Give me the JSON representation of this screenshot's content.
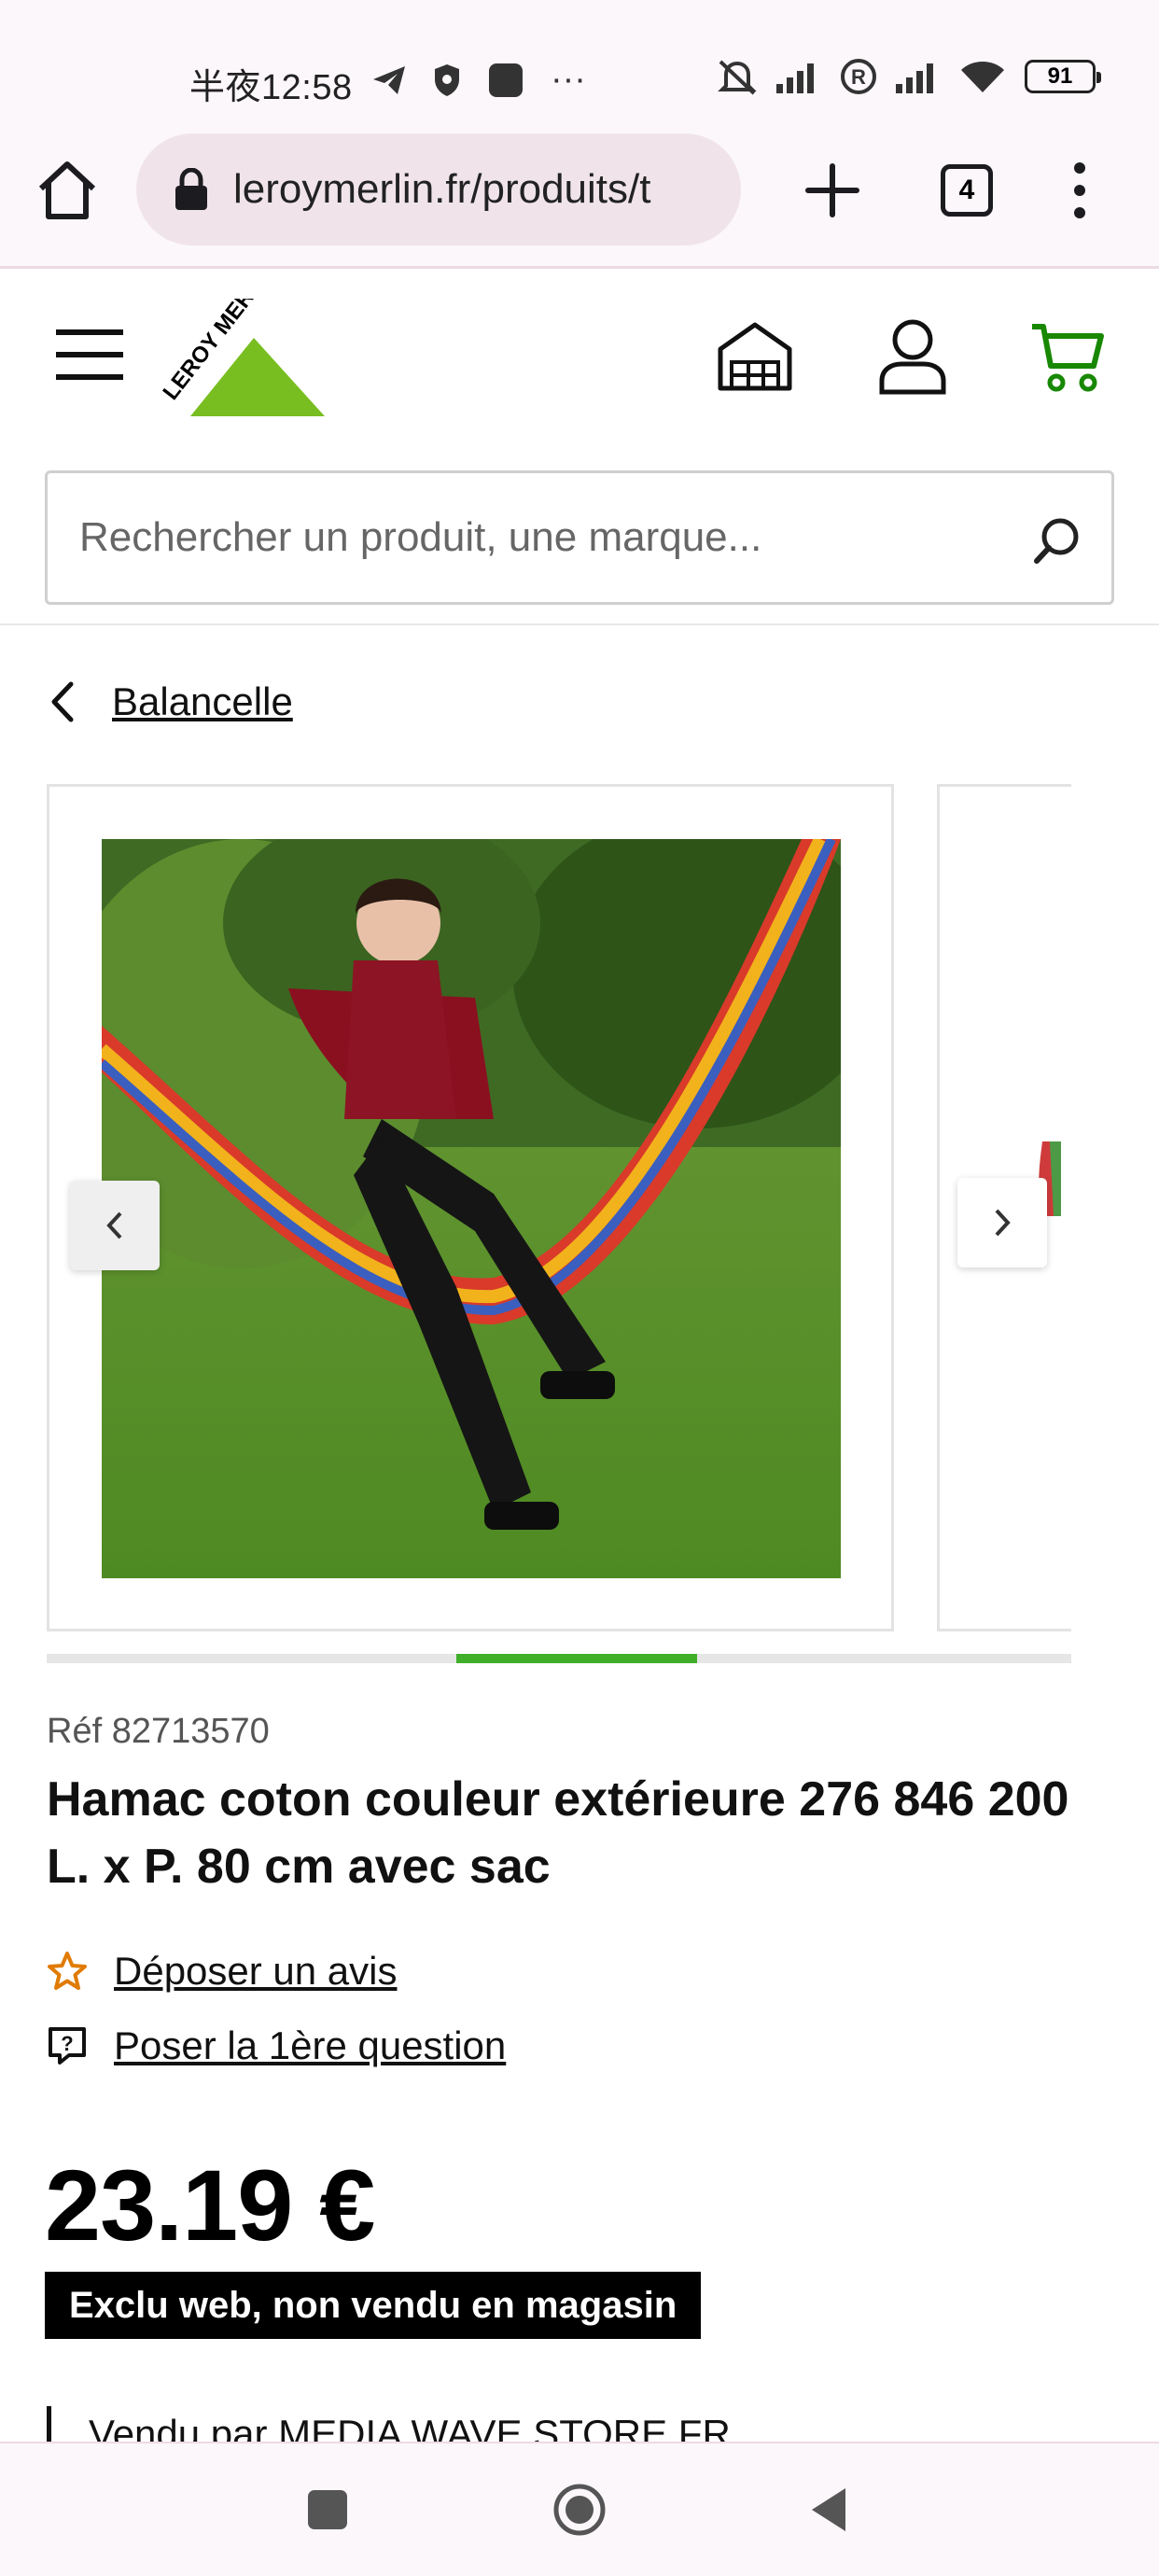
{
  "status_bar": {
    "time": "半夜12:58",
    "overflow": "···",
    "battery": "91"
  },
  "browser": {
    "url": "leroymerlin.fr/produits/t",
    "tab_count": "4"
  },
  "header": {
    "logo_text": "LEROY MERLIN",
    "search_placeholder": "Rechercher un produit, une marque..."
  },
  "breadcrumb": {
    "label": "Balancelle"
  },
  "carousel": {
    "current_slide_fraction_start": 0.4,
    "current_slide_fraction_end": 0.635
  },
  "product": {
    "ref": "Réf 82713570",
    "title": "Hamac coton couleur extérieure 276 846 200 L. x P. 80 cm avec sac",
    "review_link": "Déposer un avis",
    "question_link": "Poser la 1ère question",
    "price": "23.19 €",
    "badge": "Exclu web, non vendu en magasin",
    "seller": "Vendu par MEDIA WAVE STORE FR"
  },
  "colors": {
    "brand_green": "#78be20",
    "accent_green": "#3fae29",
    "review_star": "#e07b00"
  }
}
